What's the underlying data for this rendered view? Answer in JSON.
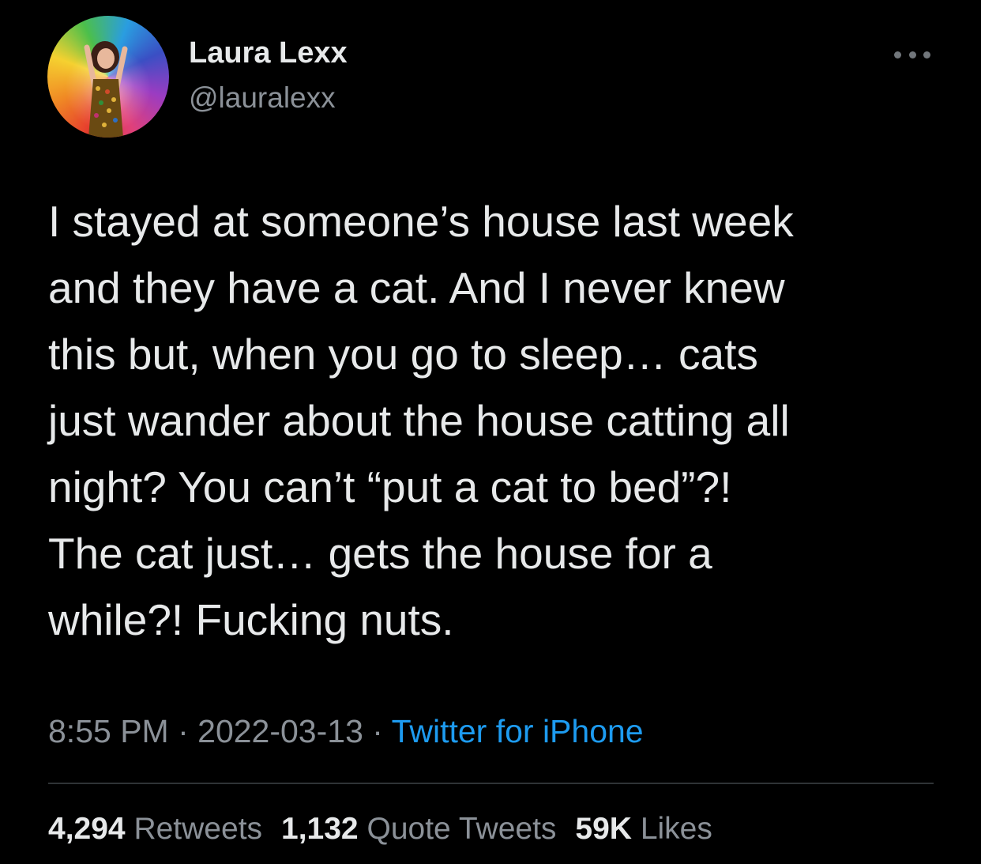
{
  "author": {
    "display_name": "Laura Lexx",
    "handle": "@lauralexx",
    "avatar_icon": "profile-photo-rainbow-umbrella"
  },
  "tweet": {
    "lines": [
      "I stayed at someone’s house last week",
      "and they have a cat. And I never knew",
      "this but, when you go to sleep… cats",
      "just wander about the house catting all",
      "night? You can’t “put a cat to bed”?!",
      "The cat just… gets the house for a",
      "while?! Fucking nuts."
    ]
  },
  "meta": {
    "time": "8:55 PM",
    "separator": " · ",
    "date": "2022-03-13",
    "source": "Twitter for iPhone"
  },
  "stats": {
    "retweets_count": "4,294",
    "retweets_label": "Retweets",
    "quotes_count": "1,132",
    "quotes_label": "Quote Tweets",
    "likes_count": "59K",
    "likes_label": "Likes"
  },
  "colors": {
    "background": "#000000",
    "text": "#e7e9ea",
    "secondary": "#8b9198",
    "link": "#1d9bf0",
    "divider": "#2f3336"
  }
}
